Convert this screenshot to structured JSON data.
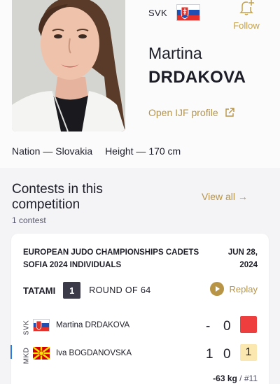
{
  "athlete": {
    "country_code": "SVK",
    "first_name": "Martina",
    "last_name": "DRDAKOVA",
    "follow_label": "Follow",
    "ijf_link": "Open IJF profile",
    "nation_label": "Nation",
    "nation_value": "Slovakia",
    "height_label": "Height",
    "height_value": "170 cm"
  },
  "contests": {
    "title": "Contests in this competition",
    "view_all": "View all",
    "count": "1 contest"
  },
  "contest": {
    "event": "EUROPEAN JUDO CHAMPIONSHIPS CADETS SOFIA 2024 INDIVIDUALS",
    "date_line1": "JUN 28,",
    "date_line2": "2024",
    "tatami_label": "TATAMI",
    "tatami_number": "1",
    "round": "ROUND OF 64",
    "replay_label": "Replay",
    "competitors": [
      {
        "code": "SVK",
        "name": "Martina DRDAKOVA",
        "ippon": "-",
        "waza": "0",
        "penalty": "",
        "penalty_color": "#ee3e3e",
        "winner": false
      },
      {
        "code": "MKD",
        "name": "Iva BOGDANOVSKA",
        "ippon": "1",
        "waza": "0",
        "penalty": "1",
        "penalty_color": "#fbe7b0",
        "winner": true
      }
    ],
    "weight": "-63 kg",
    "contest_number": "#11"
  },
  "colors": {
    "accent_gold": "#b89446",
    "winner_blue": "#2b7bd6",
    "penalty_red": "#ee3e3e",
    "penalty_yellow": "#fbe7b0"
  }
}
